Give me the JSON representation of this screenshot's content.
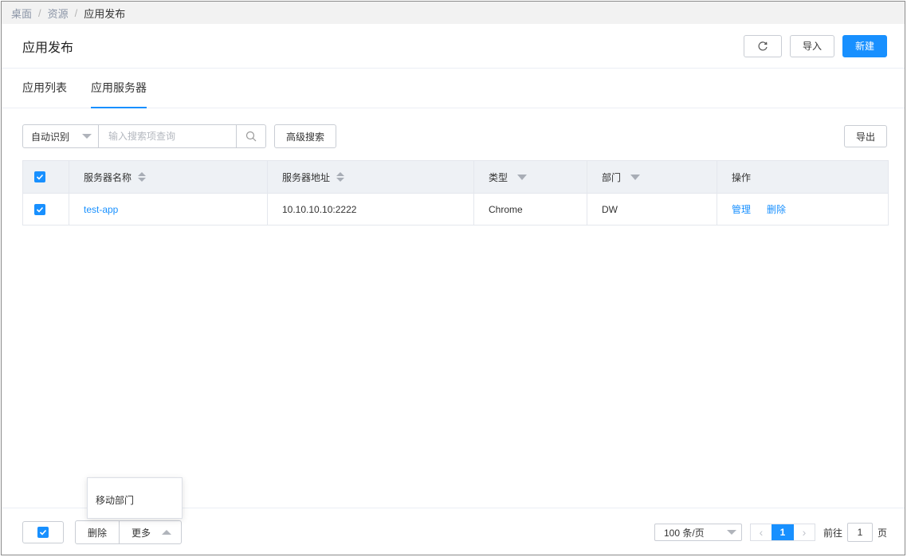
{
  "breadcrumb": {
    "items": [
      "桌面",
      "资源"
    ],
    "current": "应用发布",
    "separator": "/"
  },
  "header": {
    "title": "应用发布",
    "refresh_icon": "refresh-icon",
    "import_label": "导入",
    "new_label": "新建"
  },
  "tabs": [
    {
      "label": "应用列表",
      "active": false
    },
    {
      "label": "应用服务器",
      "active": true
    }
  ],
  "search": {
    "mode": "自动识别",
    "placeholder": "输入搜索项查询",
    "value": "",
    "advanced_label": "高级搜索",
    "export_label": "导出"
  },
  "table": {
    "headers": [
      "服务器名称",
      "服务器地址",
      "类型",
      "部门",
      "操作"
    ],
    "rows": [
      {
        "checked": true,
        "name": "test-app",
        "address": "10.10.10.10:2222",
        "type": "Chrome",
        "dept": "DW",
        "actions": [
          "管理",
          "删除"
        ]
      }
    ]
  },
  "popover": {
    "item": "移动部门"
  },
  "footer": {
    "delete_label": "删除",
    "more_label": "更多",
    "page_size": "100 条/页",
    "current_page": "1",
    "goto_label": "前往",
    "goto_value": "1",
    "goto_suffix": "页"
  },
  "colors": {
    "primary": "#1890ff",
    "header_bg": "#eef1f5",
    "crumb_bg": "#f2f2f2"
  }
}
